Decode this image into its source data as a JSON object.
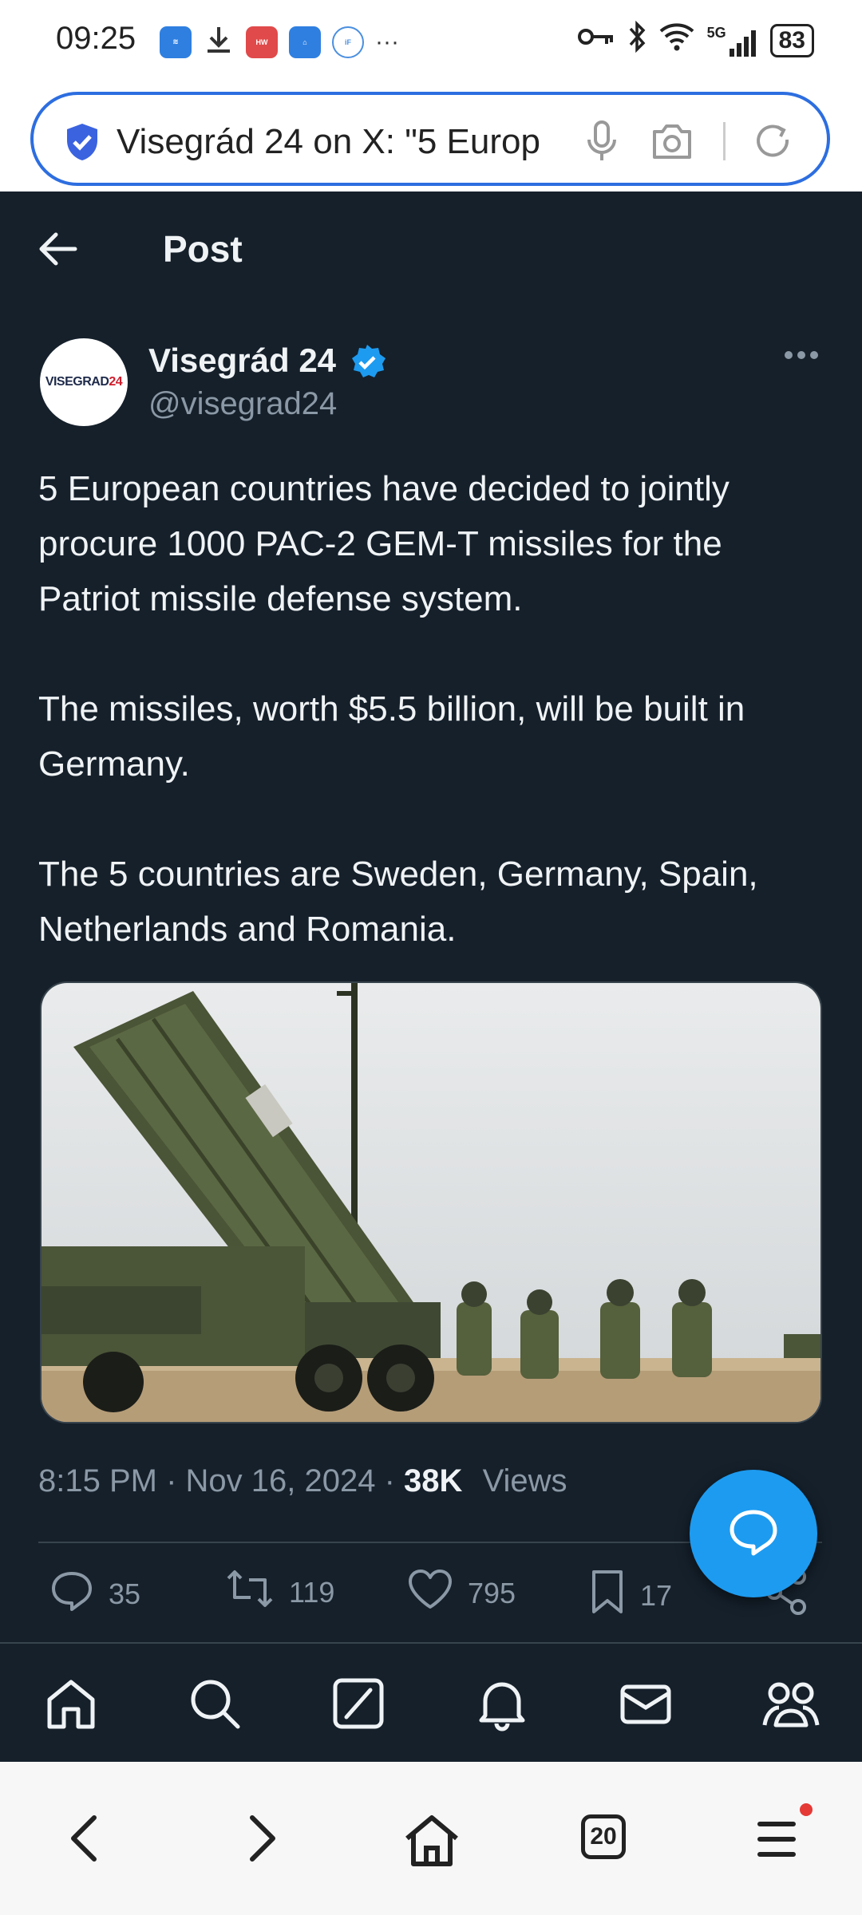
{
  "status_bar": {
    "time": "09:25",
    "battery": "83",
    "network": "5G"
  },
  "browser": {
    "url_text": "Visegrád 24 on X: \"5 Europ",
    "tab_count": "20"
  },
  "header": {
    "title": "Post"
  },
  "author": {
    "name": "Visegrád 24",
    "handle": "@visegrad24",
    "avatar_text_main": "VISEGRAD",
    "avatar_text_accent": "24"
  },
  "tweet": {
    "text": "5 European countries have decided to jointly procure 1000 PAC-2 GEM-T missiles for the Patriot missile defense system.\n\nThe missiles, worth $5.5 billion, will be built in Germany.\n\nThe 5 countries are Sweden, Germany, Spain, Netherlands and Romania.",
    "time": "8:15 PM",
    "date": "Nov 16, 2024",
    "views_count": "38K",
    "views_label": "Views"
  },
  "actions": {
    "replies": "35",
    "reposts": "119",
    "likes": "795",
    "bookmarks": "17"
  },
  "colors": {
    "background": "#15202b",
    "accent": "#1d9bf0",
    "muted_text": "#8b98a5"
  }
}
